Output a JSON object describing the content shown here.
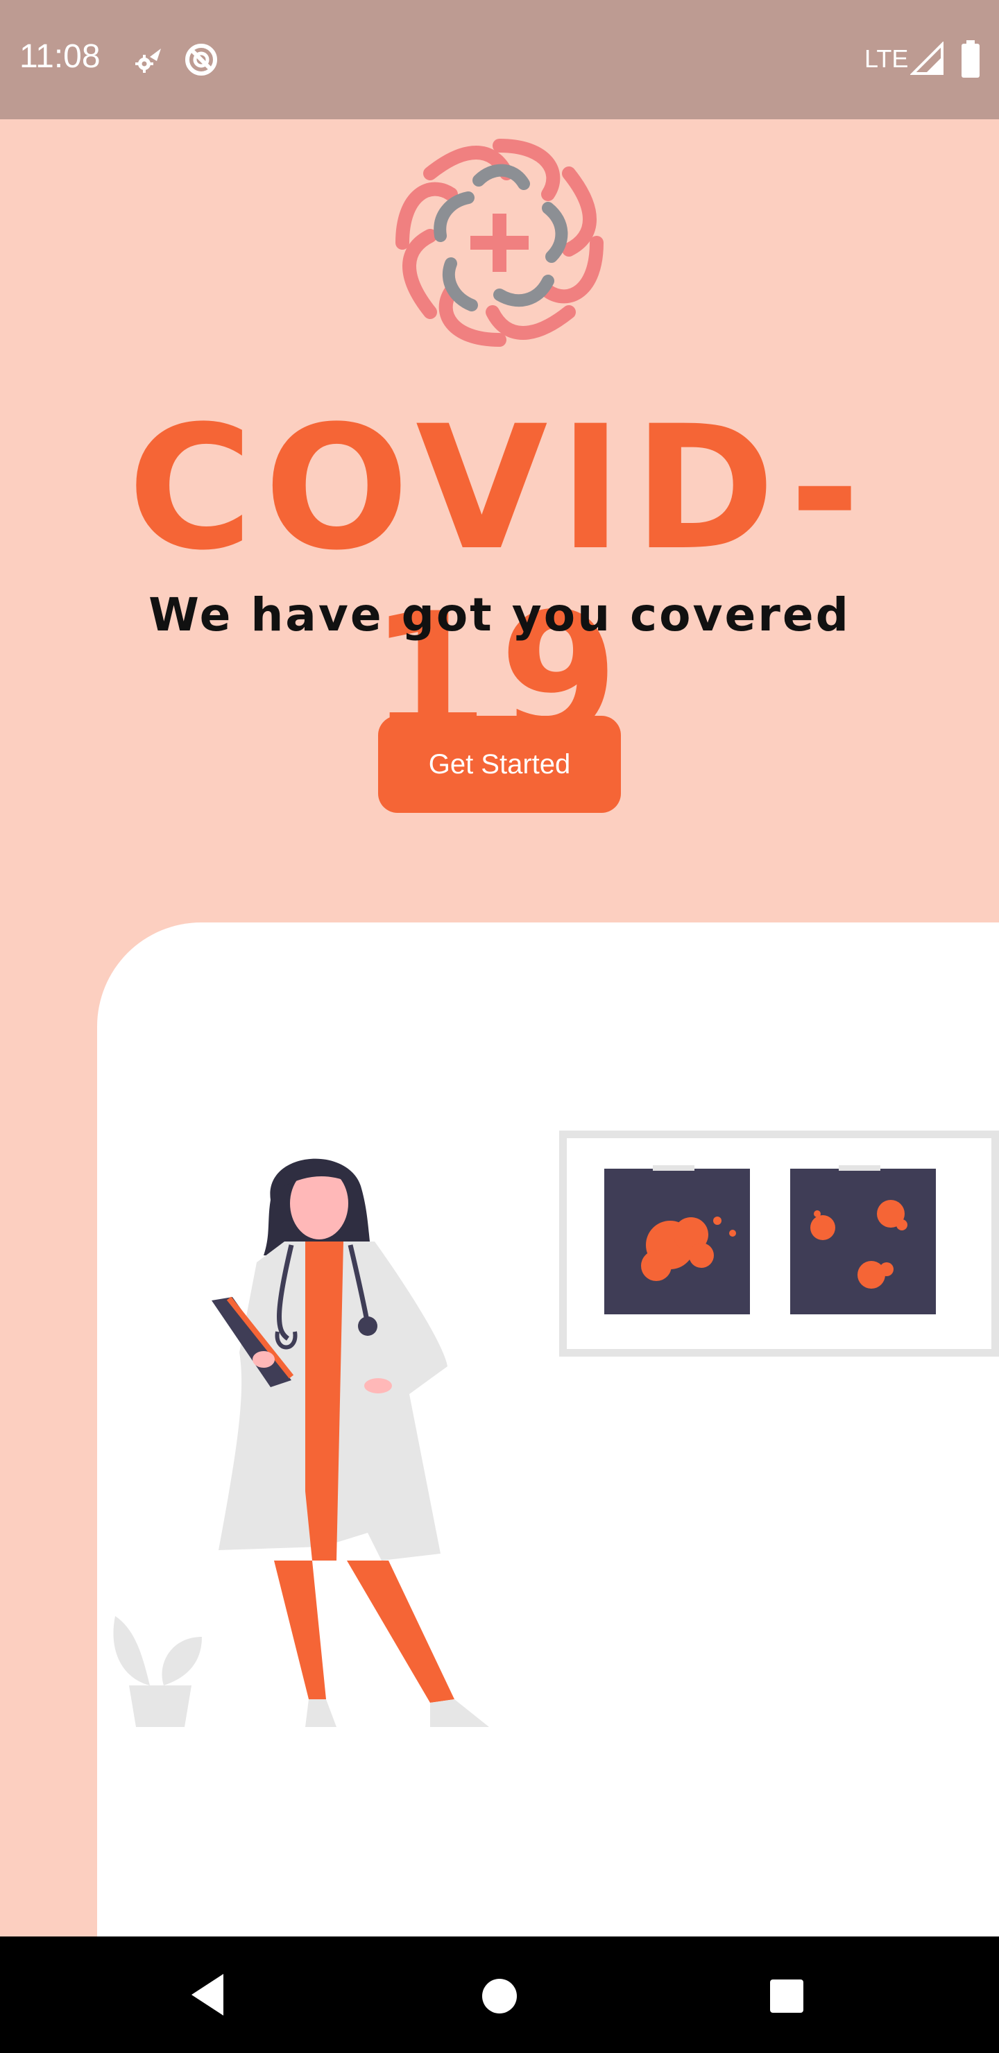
{
  "status_bar": {
    "time": "11:08",
    "network": "LTE",
    "icons": [
      "settings-notification-icon",
      "do-not-disturb-icon",
      "signal-icon",
      "battery-icon"
    ]
  },
  "logo": {
    "icon": "medical-knot-cross-icon"
  },
  "hero": {
    "title": "COVID-19",
    "subtitle": "We have got you covered",
    "cta_label": "Get Started"
  },
  "illustration": {
    "description_icons": [
      "doctor-illustration",
      "xray-frame-illustration",
      "plant-illustration"
    ]
  },
  "nav_bar": {
    "buttons": [
      "back",
      "home",
      "recents"
    ]
  },
  "colors": {
    "accent": "#F56536",
    "background": "#FCCFC0",
    "status_bar": "#BD9B92",
    "card": "#FFFFFF",
    "dark": "#3F3D56"
  }
}
